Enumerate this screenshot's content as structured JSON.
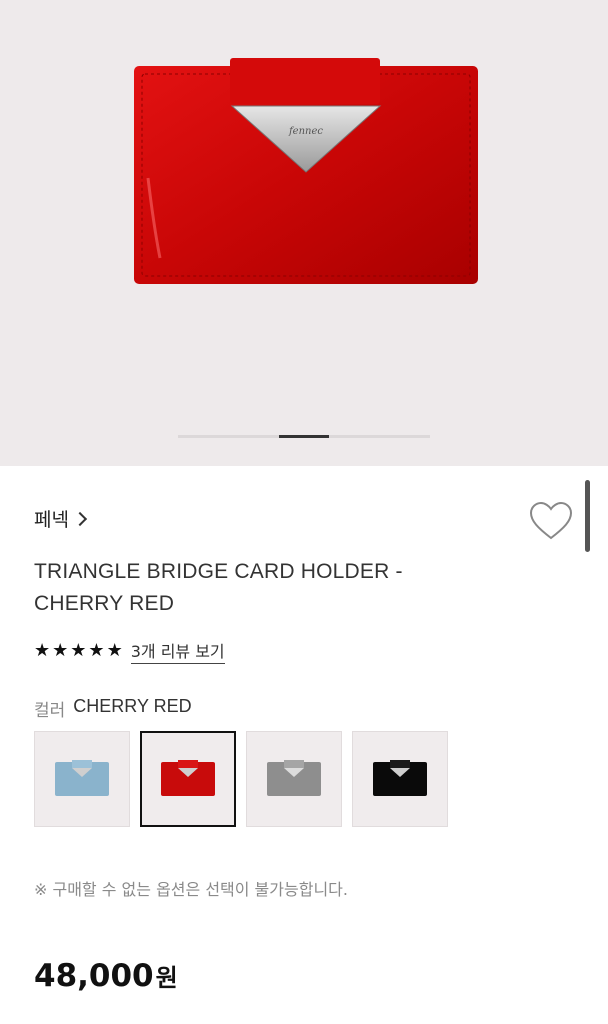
{
  "hero": {
    "image_label": "fennec",
    "pager": {
      "count": 3,
      "active_index": 1
    }
  },
  "product": {
    "brand": "페넥",
    "title_line1": "TRIANGLE BRIDGE CARD HOLDER -",
    "title_line2": "CHERRY RED",
    "rating": {
      "stars": 5,
      "review_link": "3개 리뷰 보기"
    },
    "color": {
      "label": "컬러",
      "value": "CHERRY RED"
    },
    "swatches": [
      {
        "color": "#8ab3cc",
        "name": "sky blue"
      },
      {
        "color": "#c80b0b",
        "name": "cherry red",
        "selected": true
      },
      {
        "color": "#8e8e8e",
        "name": "silver"
      },
      {
        "color": "#0a0a0a",
        "name": "black"
      }
    ],
    "notice": "※ 구매할 수 없는 옵션은 선택이 불가능합니다.",
    "price": {
      "amount": "48,000",
      "currency": "원"
    }
  },
  "colors": {
    "accent": "#c80b0b",
    "hero_bg": "#eeeaeb",
    "text": "#222222"
  },
  "icons": {
    "wishlist": "heart-icon",
    "brand_arrow": "chevron-right-icon",
    "star": "star-icon"
  }
}
